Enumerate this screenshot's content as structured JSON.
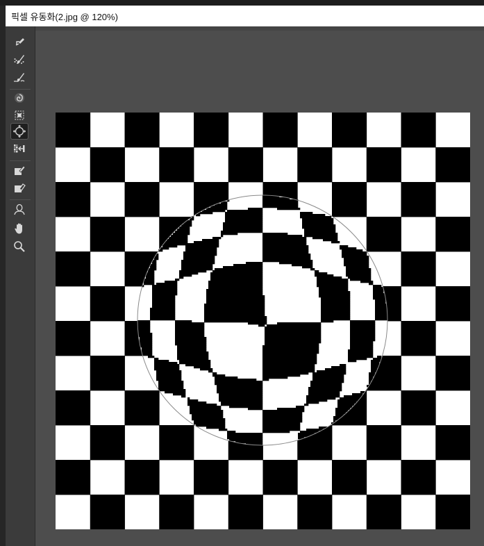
{
  "window": {
    "title": "픽셀 유동화(2.jpg @ 120%)"
  },
  "toolbar": {
    "tools": [
      {
        "name": "forward-warp-tool",
        "icon": "warp-brush-icon",
        "active": false
      },
      {
        "name": "reconstruct-tool",
        "icon": "reconstruct-brush-icon",
        "active": false
      },
      {
        "name": "smooth-tool",
        "icon": "smooth-brush-icon",
        "active": false
      },
      {
        "name": "twirl-clockwise-tool",
        "icon": "twirl-icon",
        "active": false
      },
      {
        "name": "pucker-tool",
        "icon": "pucker-icon",
        "active": false
      },
      {
        "name": "bloat-tool",
        "icon": "bloat-icon",
        "active": true
      },
      {
        "name": "push-left-tool",
        "icon": "push-left-icon",
        "active": false
      },
      {
        "name": "freeze-mask-tool",
        "icon": "freeze-mask-icon",
        "active": false
      },
      {
        "name": "thaw-mask-tool",
        "icon": "thaw-mask-icon",
        "active": false
      },
      {
        "name": "face-tool",
        "icon": "face-icon",
        "active": false
      },
      {
        "name": "hand-tool",
        "icon": "hand-icon",
        "active": false
      },
      {
        "name": "zoom-tool",
        "icon": "zoom-icon",
        "active": false
      }
    ]
  },
  "canvas": {
    "grid_squares": 12,
    "colors": {
      "dark": "#000000",
      "light": "#ffffff"
    },
    "brush_outline_color": "#8a8a8a",
    "distortion": "bloat"
  }
}
